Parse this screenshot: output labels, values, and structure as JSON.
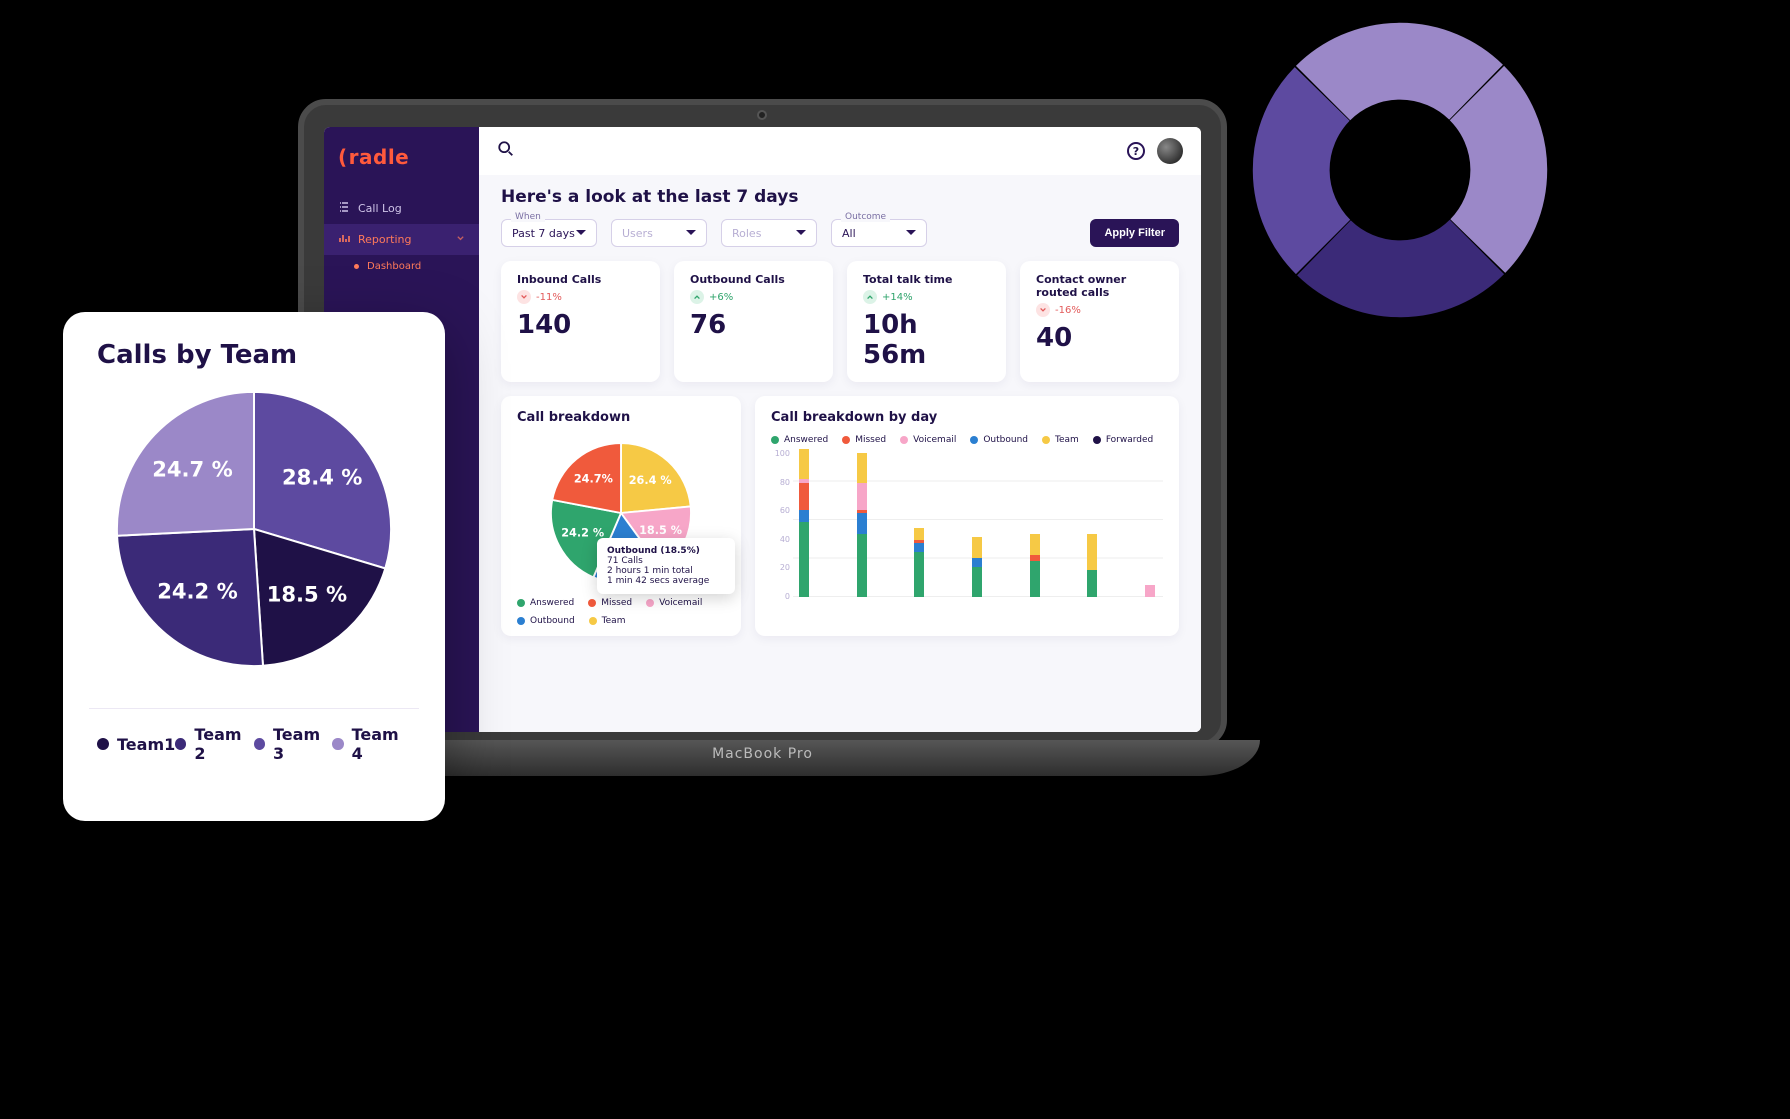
{
  "brand": "radle",
  "sidebar": {
    "items": [
      {
        "label": "Call Log"
      },
      {
        "label": "Reporting"
      }
    ],
    "subitems": [
      {
        "label": "Dashboard"
      }
    ]
  },
  "header": {
    "title": "Here's a look at the last 7 days",
    "help_glyph": "?"
  },
  "filters": [
    {
      "label": "When",
      "value": "Past 7 days",
      "placeholder": false
    },
    {
      "label": "",
      "value": "Users",
      "placeholder": true
    },
    {
      "label": "",
      "value": "Roles",
      "placeholder": true
    },
    {
      "label": "Outcome",
      "value": "All",
      "placeholder": false
    }
  ],
  "apply_button": "Apply Filter",
  "kpis": [
    {
      "label": "Inbound Calls",
      "delta": "-11%",
      "dir": "neg",
      "value": "140"
    },
    {
      "label": "Outbound Calls",
      "delta": "+6%",
      "dir": "pos",
      "value": "76"
    },
    {
      "label": "Total talk time",
      "delta": "+14%",
      "dir": "pos",
      "value": "10h 56m"
    },
    {
      "label": "Contact owner routed calls",
      "delta": "-16%",
      "dir": "neg",
      "value": "40"
    }
  ],
  "breakdown_card_title": "Call breakdown",
  "breakdown_by_day_title": "Call breakdown by day",
  "tooltip": {
    "title": "Outbound (18.5%)",
    "line1": "71 Calls",
    "line2": "2 hours 1 min total",
    "line3": "1 min 42 secs average"
  },
  "call_legend": [
    {
      "name": "Answered",
      "color": "#2fa56d"
    },
    {
      "name": "Missed",
      "color": "#f05a3c"
    },
    {
      "name": "Voicemail",
      "color": "#f7a6c8"
    },
    {
      "name": "Outbound",
      "color": "#2b7fd1"
    },
    {
      "name": "Team",
      "color": "#f6c945"
    },
    {
      "name": "Forwarded",
      "color": "#1f1147"
    }
  ],
  "tablet": {
    "title": "Calls by Team",
    "legend": [
      {
        "name": "Team1",
        "color": "#1f1147"
      },
      {
        "name": "Team 2",
        "color": "#3b2a78"
      },
      {
        "name": "Team 3",
        "color": "#5d4aa0"
      },
      {
        "name": "Team 4",
        "color": "#9b88c8"
      }
    ]
  },
  "laptop_label": "MacBook Pro",
  "chart_data": [
    {
      "type": "pie",
      "title": "Calls by Team",
      "series": [
        {
          "name": "Team 3",
          "value": 28.4,
          "color": "#5d4aa0"
        },
        {
          "name": "Team1",
          "value": 18.5,
          "color": "#1f1147"
        },
        {
          "name": "Team 2",
          "value": 24.2,
          "color": "#3b2a78"
        },
        {
          "name": "Team 4",
          "value": 24.7,
          "color": "#9b88c8"
        }
      ],
      "labels_shown": [
        "28.4 %",
        "18.5 %",
        "24.2 %",
        "24.7 %"
      ]
    },
    {
      "type": "pie",
      "title": "Call breakdown",
      "series": [
        {
          "name": "Team",
          "value": 26.4,
          "color": "#f6c945",
          "label": "26.4 %"
        },
        {
          "name": "Voicemail",
          "value": 18.5,
          "color": "#f7a6c8",
          "label": "18.5 %"
        },
        {
          "name": "Outbound",
          "value": 18.5,
          "color": "#2b7fd1",
          "label": "18.5 %"
        },
        {
          "name": "Answered",
          "value": 24.2,
          "color": "#2fa56d",
          "label": "24.2 %"
        },
        {
          "name": "Missed",
          "value": 24.7,
          "color": "#f05a3c",
          "label": "24.7%"
        }
      ]
    },
    {
      "type": "bar",
      "title": "Call breakdown by day",
      "ylim": [
        0,
        100
      ],
      "yticks": [
        0,
        20,
        40,
        60,
        80,
        100
      ],
      "categories": [
        "",
        "",
        "",
        "",
        "",
        "",
        ""
      ],
      "stack_order": [
        "Answered",
        "Outbound",
        "Missed",
        "Voicemail",
        "Team"
      ],
      "colors": {
        "Answered": "#2fa56d",
        "Outbound": "#2b7fd1",
        "Missed": "#f05a3c",
        "Voicemail": "#f7a6c8",
        "Team": "#f6c945",
        "Forwarded": "#1f1147"
      },
      "series": [
        {
          "name": "Answered",
          "values": [
            50,
            42,
            30,
            20,
            24,
            18,
            0
          ]
        },
        {
          "name": "Outbound",
          "values": [
            8,
            14,
            6,
            6,
            0,
            0,
            0
          ]
        },
        {
          "name": "Missed",
          "values": [
            18,
            2,
            2,
            0,
            4,
            0,
            0
          ]
        },
        {
          "name": "Voicemail",
          "values": [
            3,
            18,
            0,
            0,
            0,
            0,
            8
          ]
        },
        {
          "name": "Team",
          "values": [
            20,
            20,
            8,
            14,
            14,
            24,
            0
          ]
        }
      ]
    }
  ]
}
